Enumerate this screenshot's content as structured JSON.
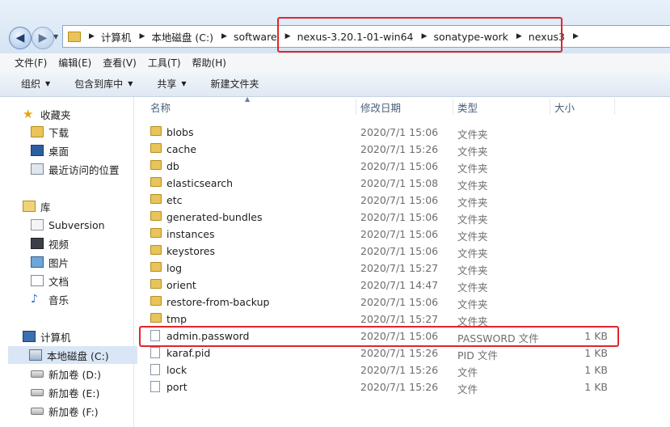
{
  "address": {
    "crumbs": [
      "计算机",
      "本地磁盘 (C:)",
      "software",
      "nexus-3.20.1-01-win64",
      "sonatype-work",
      "nexus3"
    ]
  },
  "menu": [
    "文件(F)",
    "编辑(E)",
    "查看(V)",
    "工具(T)",
    "帮助(H)"
  ],
  "toolbar": {
    "organize": "组织",
    "include_library": "包含到库中",
    "share": "共享",
    "new_folder": "新建文件夹"
  },
  "nav": {
    "favorites": "收藏夹",
    "downloads": "下载",
    "desktop": "桌面",
    "recent": "最近访问的位置",
    "libraries": "库",
    "subversion": "Subversion",
    "videos": "视频",
    "pictures": "图片",
    "documents": "文档",
    "music": "音乐",
    "computer": "计算机",
    "drive_c": "本地磁盘 (C:)",
    "drive_d": "新加卷 (D:)",
    "drive_e": "新加卷 (E:)",
    "drive_f": "新加卷 (F:)"
  },
  "columns": {
    "name": "名称",
    "date": "修改日期",
    "type": "类型",
    "size": "大小"
  },
  "files": [
    {
      "name": "blobs",
      "date": "2020/7/1 15:06",
      "type": "文件夹",
      "size": "",
      "kind": "folder"
    },
    {
      "name": "cache",
      "date": "2020/7/1 15:26",
      "type": "文件夹",
      "size": "",
      "kind": "folder"
    },
    {
      "name": "db",
      "date": "2020/7/1 15:06",
      "type": "文件夹",
      "size": "",
      "kind": "folder"
    },
    {
      "name": "elasticsearch",
      "date": "2020/7/1 15:08",
      "type": "文件夹",
      "size": "",
      "kind": "folder"
    },
    {
      "name": "etc",
      "date": "2020/7/1 15:06",
      "type": "文件夹",
      "size": "",
      "kind": "folder"
    },
    {
      "name": "generated-bundles",
      "date": "2020/7/1 15:06",
      "type": "文件夹",
      "size": "",
      "kind": "folder"
    },
    {
      "name": "instances",
      "date": "2020/7/1 15:06",
      "type": "文件夹",
      "size": "",
      "kind": "folder"
    },
    {
      "name": "keystores",
      "date": "2020/7/1 15:06",
      "type": "文件夹",
      "size": "",
      "kind": "folder"
    },
    {
      "name": "log",
      "date": "2020/7/1 15:27",
      "type": "文件夹",
      "size": "",
      "kind": "folder"
    },
    {
      "name": "orient",
      "date": "2020/7/1 14:47",
      "type": "文件夹",
      "size": "",
      "kind": "folder"
    },
    {
      "name": "restore-from-backup",
      "date": "2020/7/1 15:06",
      "type": "文件夹",
      "size": "",
      "kind": "folder"
    },
    {
      "name": "tmp",
      "date": "2020/7/1 15:27",
      "type": "文件夹",
      "size": "",
      "kind": "folder"
    },
    {
      "name": "admin.password",
      "date": "2020/7/1 15:06",
      "type": "PASSWORD 文件",
      "size": "1 KB",
      "kind": "file"
    },
    {
      "name": "karaf.pid",
      "date": "2020/7/1 15:26",
      "type": "PID 文件",
      "size": "1 KB",
      "kind": "file"
    },
    {
      "name": "lock",
      "date": "2020/7/1 15:26",
      "type": "文件",
      "size": "1 KB",
      "kind": "file"
    },
    {
      "name": "port",
      "date": "2020/7/1 15:26",
      "type": "文件",
      "size": "1 KB",
      "kind": "file"
    }
  ]
}
